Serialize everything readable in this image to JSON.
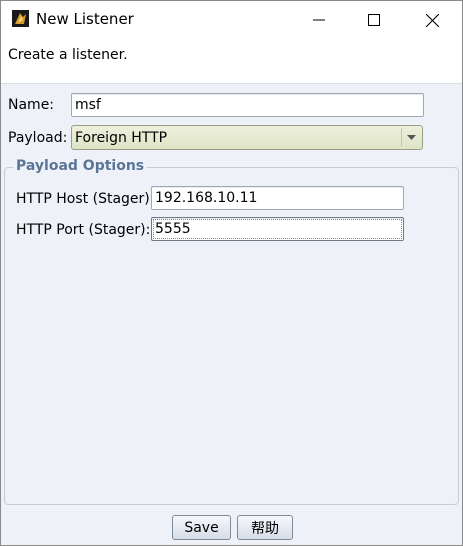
{
  "window": {
    "title": "New Listener",
    "description": "Create a listener."
  },
  "form": {
    "name_label": "Name:",
    "name_value": "msf",
    "payload_label": "Payload:",
    "payload_value": "Foreign HTTP"
  },
  "payload_options": {
    "title": "Payload Options",
    "host_label": "HTTP Host (Stager):",
    "host_value": "192.168.10.11",
    "port_label": "HTTP Port (Stager):",
    "port_value": "5555"
  },
  "buttons": {
    "save_label": "Save",
    "help_label": "帮助"
  },
  "icons": {
    "app": "cobalt-strike-icon",
    "minimize": "minimize-icon",
    "maximize": "maximize-icon",
    "close": "close-icon",
    "dropdown": "chevron-down-icon"
  }
}
